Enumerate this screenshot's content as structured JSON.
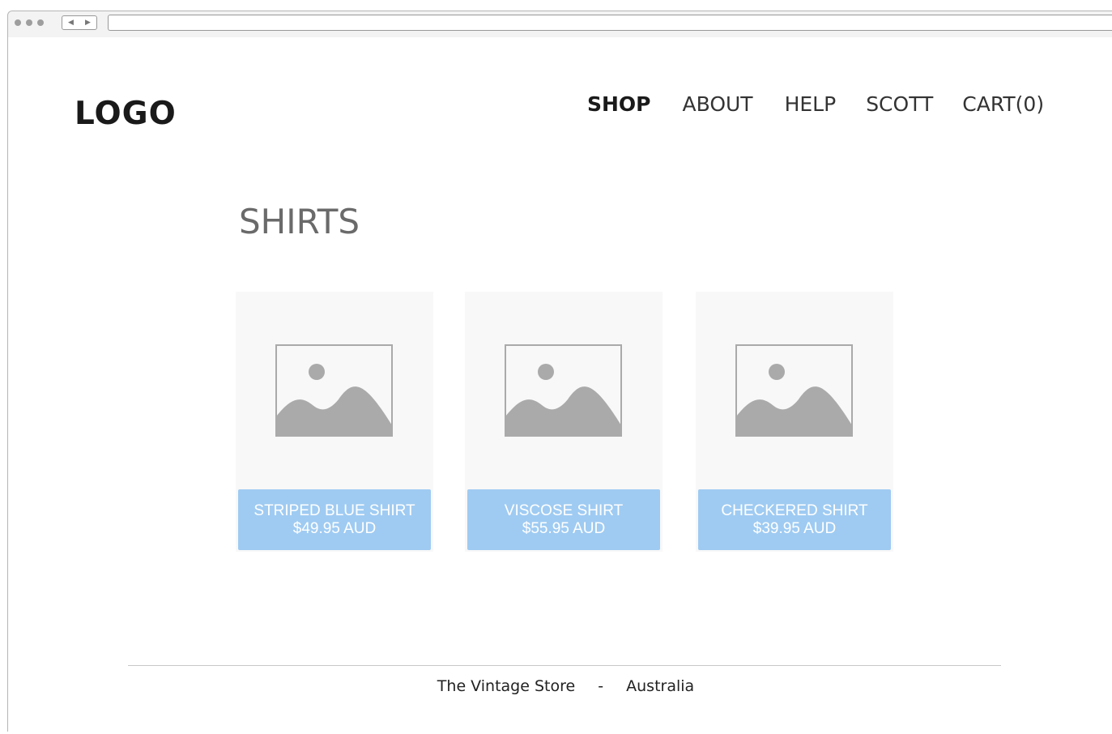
{
  "brand": {
    "logo_text": "LOGO"
  },
  "nav": {
    "items": [
      {
        "label": "SHOP",
        "active": true
      },
      {
        "label": "ABOUT",
        "active": false
      },
      {
        "label": "HELP",
        "active": false
      },
      {
        "label": "SCOTT",
        "active": false
      },
      {
        "label": "CART(0)",
        "active": false
      }
    ]
  },
  "main": {
    "title": "SHIRTS",
    "products": [
      {
        "name": "STRIPED BLUE SHIRT",
        "price": "$49.95 AUD",
        "image_icon": "image-placeholder-icon"
      },
      {
        "name": "VISCOSE SHIRT",
        "price": "$55.95 AUD",
        "image_icon": "image-placeholder-icon"
      },
      {
        "name": "CHECKERED SHIRT",
        "price": "$39.95 AUD",
        "image_icon": "image-placeholder-icon"
      }
    ]
  },
  "footer": {
    "store_name": "The Vintage Store",
    "separator": "-",
    "country": "Australia"
  },
  "colors": {
    "product_button": "#9fcbf2",
    "card_background": "#f8f8f8",
    "placeholder_gray": "#aaaaaa",
    "title_gray": "#6a6a6a"
  },
  "browser": {
    "back_icon": "chevron-left-icon",
    "forward_icon": "chevron-right-icon"
  }
}
